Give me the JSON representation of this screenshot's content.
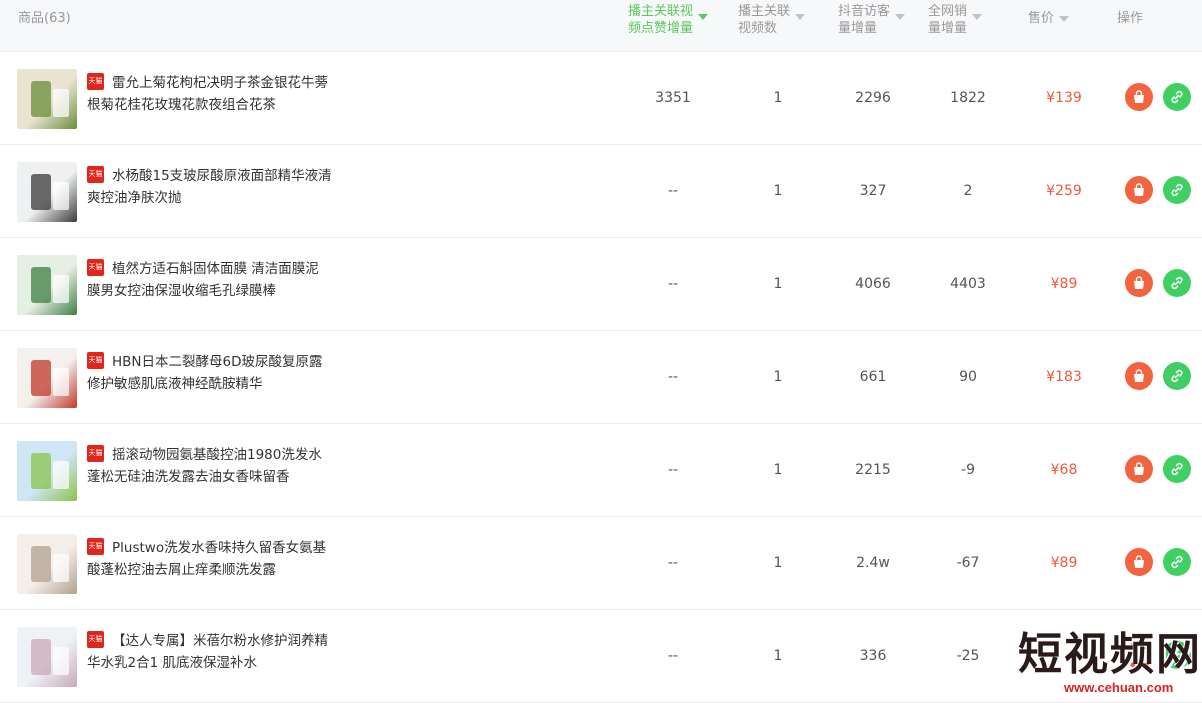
{
  "header": {
    "product": "商品(63)",
    "cols": [
      {
        "line1": "播主关联视",
        "line2": "频点赞增量",
        "active": true
      },
      {
        "line1": "播主关联",
        "line2": "视频数",
        "active": false
      },
      {
        "line1": "抖音访客",
        "line2": "量增量",
        "active": false
      },
      {
        "line1": "全网销",
        "line2": "量增量",
        "active": false
      },
      {
        "line1": "售价",
        "line2": "",
        "active": false
      }
    ],
    "op": "操作"
  },
  "badge": "天猫",
  "rows": [
    {
      "title": "雷允上菊花枸杞决明子茶金银花牛蒡根菊花桂花玫瑰花款夜组合花茶",
      "likes": "3351",
      "videos": "1",
      "visitors": "2296",
      "sales": "1822",
      "price": "¥139"
    },
    {
      "title": "水杨酸15支玻尿酸原液面部精华液清爽控油净肤次抛",
      "likes": "--",
      "videos": "1",
      "visitors": "327",
      "sales": "2",
      "price": "¥259"
    },
    {
      "title": "植然方适石斛固体面膜 清洁面膜泥膜男女控油保湿收缩毛孔绿膜棒",
      "likes": "--",
      "videos": "1",
      "visitors": "4066",
      "sales": "4403",
      "price": "¥89"
    },
    {
      "title": "HBN日本二裂酵母6D玻尿酸复原露修护敏感肌底液神经酰胺精华",
      "likes": "--",
      "videos": "1",
      "visitors": "661",
      "sales": "90",
      "price": "¥183"
    },
    {
      "title": "摇滚动物园氨基酸控油1980洗发水蓬松无硅油洗发露去油女香味留香",
      "likes": "--",
      "videos": "1",
      "visitors": "2215",
      "sales": "-9",
      "price": "¥68"
    },
    {
      "title": "Plustwo洗发水香味持久留香女氨基酸蓬松控油去屑止痒柔顺洗发露",
      "likes": "--",
      "videos": "1",
      "visitors": "2.4w",
      "sales": "-67",
      "price": "¥89"
    },
    {
      "title": "【达人专属】米蓓尔粉水修护润养精华水乳2合1 肌底液保湿补水",
      "likes": "--",
      "videos": "1",
      "visitors": "336",
      "sales": "-25",
      "price": ""
    }
  ],
  "watermark": {
    "text": "短视频网",
    "url": "www.cehuan.com"
  },
  "colors": {
    "accent_green": "#5cc85c",
    "price_red": "#f15a3a",
    "bag_orange": "#f2643f",
    "link_green": "#3fcf62",
    "tmall_red": "#e1251b"
  },
  "icons": {
    "action1": "shopping-bag-icon",
    "action2": "link-icon"
  }
}
